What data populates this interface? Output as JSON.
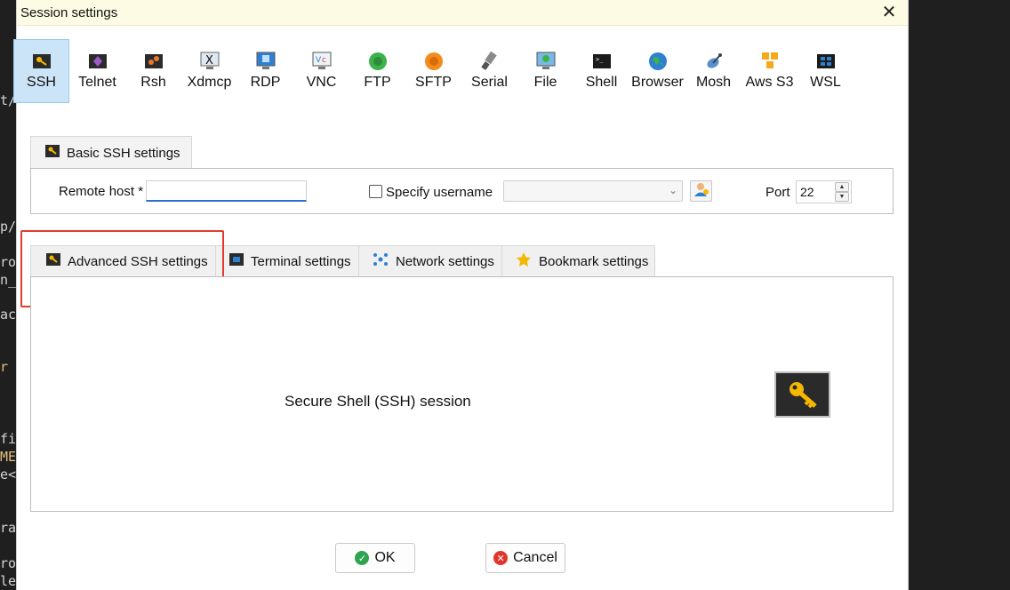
{
  "background_terminal": {
    "lines": [
      {
        "text": "t/",
        "color": "default"
      },
      {
        "text": "p/",
        "color": "default"
      },
      {
        "text": "ro",
        "color": "default"
      },
      {
        "text": "n_",
        "color": "default"
      },
      {
        "text": "ac",
        "color": "default"
      },
      {
        "text": "r",
        "color": "yellow"
      },
      {
        "text": "fi",
        "color": "default"
      },
      {
        "text": "ME",
        "color": "yellow"
      },
      {
        "text": "e<",
        "color": "default"
      },
      {
        "text": "ra",
        "color": "default"
      },
      {
        "text": "ro",
        "color": "default"
      },
      {
        "text": "le",
        "color": "default"
      }
    ]
  },
  "dialog": {
    "title": "Session settings",
    "close_icon": "close-icon"
  },
  "session_types": [
    {
      "label": "SSH",
      "icon": "ssh-key-icon",
      "active": true
    },
    {
      "label": "Telnet",
      "icon": "telnet-icon"
    },
    {
      "label": "Rsh",
      "icon": "rsh-icon"
    },
    {
      "label": "Xdmcp",
      "icon": "xdmcp-icon"
    },
    {
      "label": "RDP",
      "icon": "rdp-icon"
    },
    {
      "label": "VNC",
      "icon": "vnc-icon"
    },
    {
      "label": "FTP",
      "icon": "ftp-icon"
    },
    {
      "label": "SFTP",
      "icon": "sftp-icon"
    },
    {
      "label": "Serial",
      "icon": "serial-icon"
    },
    {
      "label": "File",
      "icon": "file-icon"
    },
    {
      "label": "Shell",
      "icon": "shell-icon"
    },
    {
      "label": "Browser",
      "icon": "browser-icon"
    },
    {
      "label": "Mosh",
      "icon": "mosh-icon"
    },
    {
      "label": "Aws S3",
      "icon": "aws-s3-icon"
    },
    {
      "label": "WSL",
      "icon": "wsl-icon"
    }
  ],
  "basic_settings": {
    "tab_label": "Basic SSH settings",
    "remote_host_label": "Remote host *",
    "remote_host_value": "",
    "specify_username_label": "Specify username",
    "specify_username_checked": false,
    "username_value": "",
    "port_label": "Port",
    "port_value": "22"
  },
  "advanced_tabs": [
    {
      "label": "Advanced SSH settings",
      "icon": "key-icon",
      "highlighted": true
    },
    {
      "label": "Terminal settings",
      "icon": "terminal-icon"
    },
    {
      "label": "Network settings",
      "icon": "network-icon"
    },
    {
      "label": "Bookmark settings",
      "icon": "star-icon"
    }
  ],
  "panel": {
    "description": "Secure Shell (SSH) session",
    "icon": "key-icon"
  },
  "buttons": {
    "ok_label": "OK",
    "cancel_label": "Cancel"
  },
  "colors": {
    "title_bar": "#fdfbe3",
    "active_tab": "#cce4f7",
    "highlight": "#e23b2e",
    "ok_green": "#2ea44f",
    "cancel_red": "#e0352b"
  }
}
